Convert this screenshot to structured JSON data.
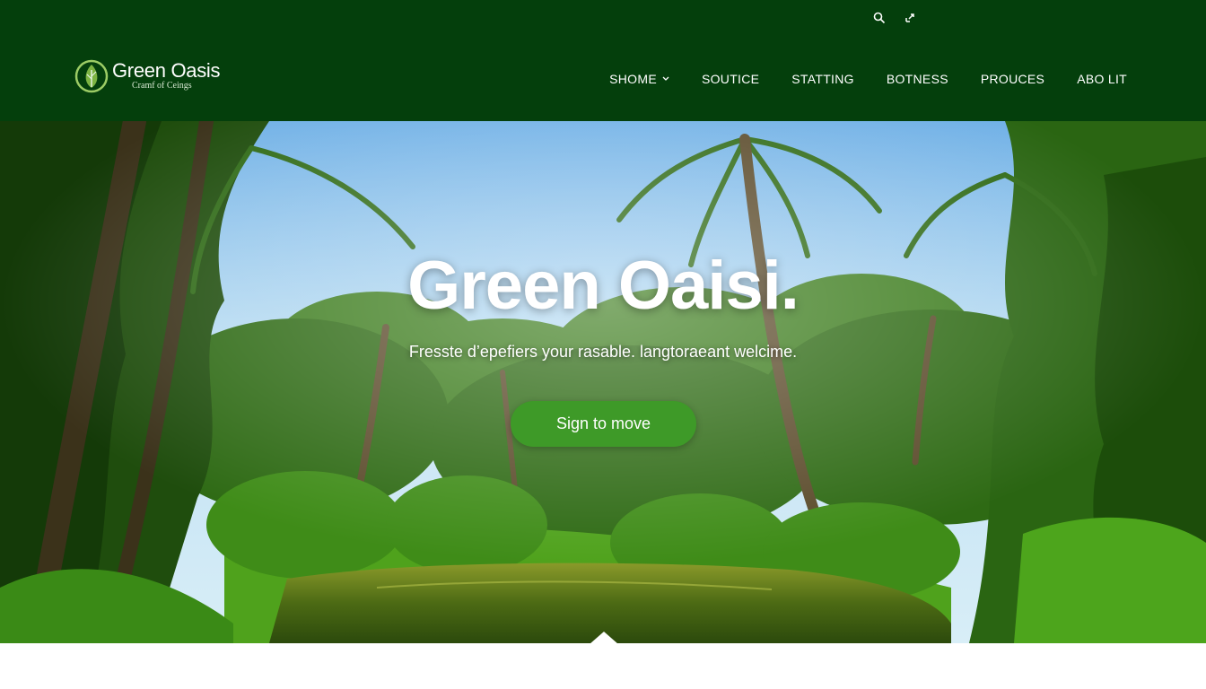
{
  "header": {
    "brand": {
      "name": "Green Oasis",
      "tagline": "Cramf of Ceings",
      "icon": "leaf-logo-icon"
    },
    "utilities": [
      {
        "icon": "search-icon"
      },
      {
        "icon": "share-icon"
      }
    ],
    "nav": [
      {
        "label": "SHOME",
        "has_dropdown": true
      },
      {
        "label": "SOUTICE"
      },
      {
        "label": "STATTING"
      },
      {
        "label": "BOTNESS"
      },
      {
        "label": "PROUCES"
      },
      {
        "label": "ABO LIT"
      }
    ]
  },
  "hero": {
    "title": "Green Oaisi.",
    "subtitle": "Fresste d’epefiers your rasable. langtoraeant welcime.",
    "cta_label": "Sign to move"
  },
  "colors": {
    "header_bg": "#043f0c",
    "cta_bg": "#3e9a28",
    "text": "#ffffff"
  }
}
